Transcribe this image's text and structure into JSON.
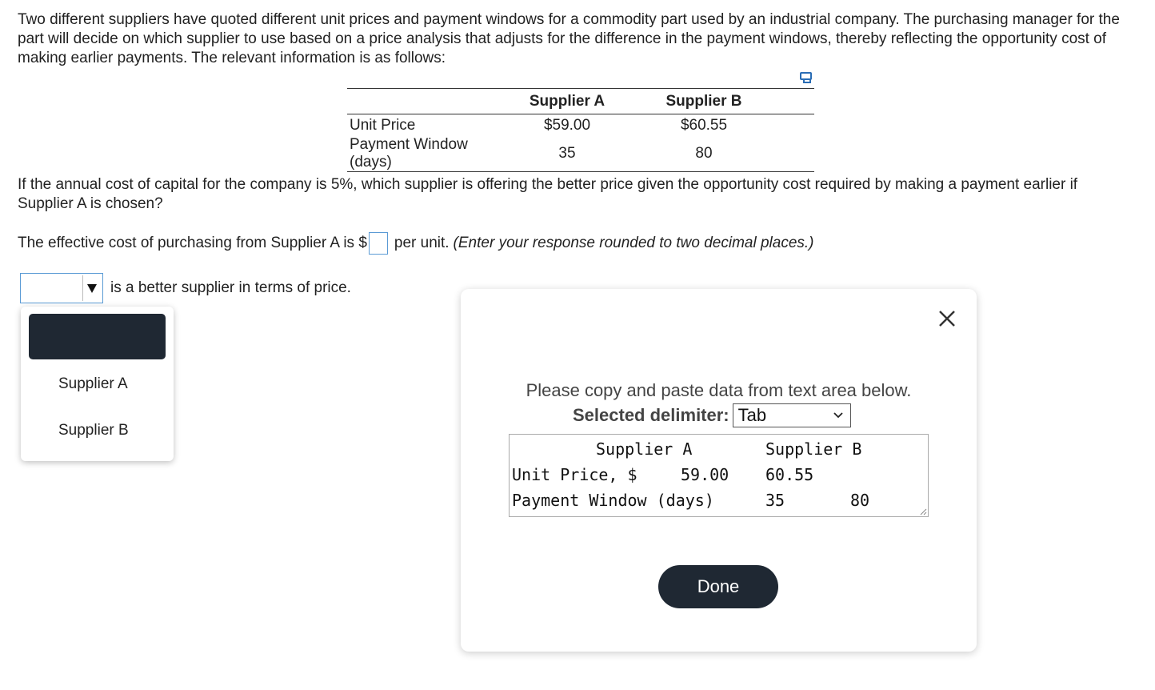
{
  "intro": "Two different suppliers have quoted different unit prices and payment windows for a commodity part used by an industrial company. The purchasing manager for the part will decide on which supplier to use based on a price analysis that adjusts for the difference in the payment windows, thereby reflecting the opportunity cost of making earlier payments. The relevant information is as follows:",
  "table": {
    "headers": [
      "",
      "Supplier A",
      "Supplier B"
    ],
    "rows": [
      {
        "label": "Unit Price",
        "a": "$59.00",
        "b": "$60.55"
      },
      {
        "label": "Payment Window (days)",
        "a": "35",
        "b": "80"
      }
    ],
    "copy_icon": "copy-data-icon"
  },
  "question": "If the annual cost of capital for the company is 5%, which supplier is offering the better price given the opportunity cost required by making a payment earlier if Supplier A is chosen?",
  "effective": {
    "prefix": "The effective cost of purchasing from Supplier A is $",
    "answer_value": "",
    "suffix": "per unit.",
    "hint": "(Enter your response rounded to two decimal places.)"
  },
  "dropdown": {
    "selected": "",
    "after_text": "is a better supplier in terms of price.",
    "options": [
      "Supplier A",
      "Supplier B"
    ]
  },
  "modal": {
    "instruction": "Please copy and paste data from text area below.",
    "delimiter_label": "Selected delimiter:",
    "delimiter_value": "Tab",
    "textarea_lines": [
      "Supplier A",
      "Supplier B",
      "Unit Price, $",
      "59.00",
      "60.55",
      "Payment Window (days)",
      "35",
      "80"
    ],
    "done_label": "Done"
  },
  "colors": {
    "dark_button": "#1f2833",
    "input_border": "#5b9bd5"
  }
}
